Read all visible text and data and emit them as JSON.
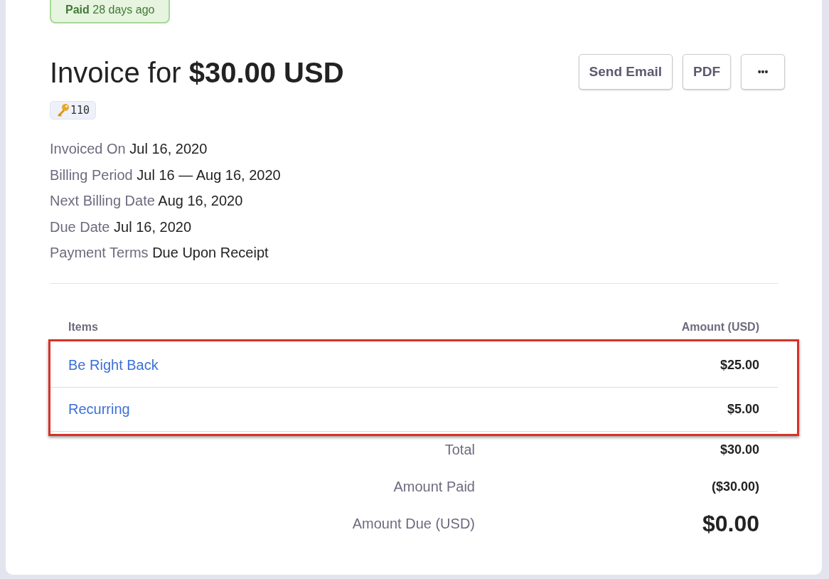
{
  "status_badge": {
    "label": "Paid",
    "text": "28 days ago"
  },
  "title": "Invoice for **$30.00 USD**",
  "id_tag": "110",
  "actions": [
    "Send Email",
    "PDF",
    "•••"
  ],
  "details": [
    {
      "label": "Invoiced On",
      "value": "Jul 16, 2020"
    },
    {
      "label": "Billing Period",
      "value": "Jul 16 — Aug 16, 2020"
    },
    {
      "label": "Next Billing Date",
      "value": "Aug 16, 2020"
    },
    {
      "label": "Due Date",
      "value": "Jul 16, 2020"
    },
    {
      "label": "Payment Terms",
      "value": "Due Upon Receipt"
    }
  ],
  "items_table": {
    "columns": [
      "Items",
      "Amount (USD)"
    ],
    "highlighted": true,
    "rows": [
      {
        "name": "Be Right Back",
        "amount": "$25.00"
      },
      {
        "name": "Recurring",
        "amount": "$5.00"
      }
    ]
  },
  "totals": [
    {
      "label": "Total",
      "value": "$30.00",
      "kind": "normal"
    },
    {
      "label": "Amount Paid",
      "value": "($30.00)",
      "kind": "normal"
    },
    {
      "label": "Amount Due (USD)",
      "value": "$0.00",
      "kind": "grand"
    }
  ]
}
